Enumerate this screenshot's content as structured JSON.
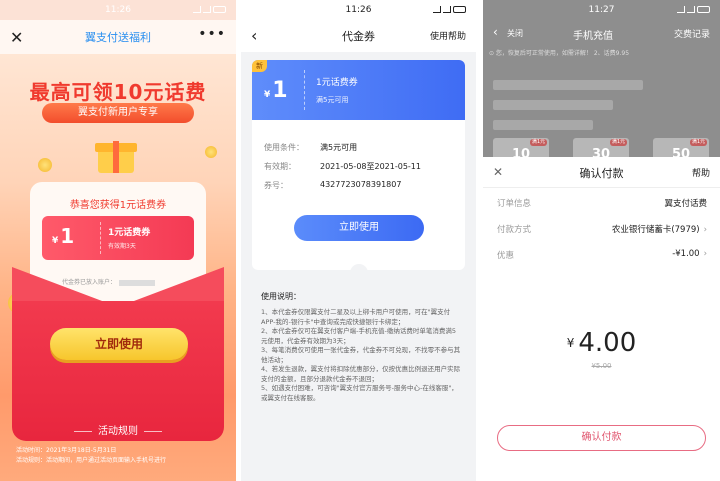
{
  "phone1": {
    "status_time": "11:26",
    "nav_title": "翼支付送福利",
    "close_glyph": "✕",
    "more_glyph": "•••",
    "hero_title": "最高可领10元话费",
    "hero_subtitle": "翼支付新用户专享",
    "congrats": "恭喜您获得1元话费券",
    "coupon_currency": "¥",
    "coupon_amount": "1",
    "coupon_name": "1元话费券",
    "coupon_validity": "有效期3天",
    "account_text": "代金券已放入账户：",
    "use_button": "立即使用",
    "rules_title": "活动规则",
    "activity_time_1": "活动时间：2021年3月18日-5月31日",
    "activity_time_2": "活动规则：活动期间，用户通过活动页面输入手机号进行"
  },
  "phone2": {
    "status_time": "11:26",
    "nav_title": "代金券",
    "back_glyph": "‹",
    "help": "使用帮助",
    "new_tag": "新",
    "currency": "¥",
    "amount": "1",
    "name": "1元话费券",
    "cond_short": "满5元可用",
    "rows": [
      {
        "label": "使用条件：",
        "value": "满5元可用"
      },
      {
        "label": "有效期：",
        "value": "2021-05-08至2021-05-11"
      },
      {
        "label": "券号：",
        "value": "4327723078391807"
      }
    ],
    "use_button": "立即使用",
    "instructions_title": "使用说明：",
    "instructions": [
      "1、本代金券仅限翼支付二星及以上绑卡用户可使用，可在\"翼支付APP-我的-银行卡\"中查询或完成快捷银行卡绑定；",
      "2、本代金券仅可在翼支付客户端-手机充值-缴纳话费时单笔消费满5元使用，代金券有效期为3天；",
      "3、每笔消费仅可使用一张代金券，代金券不可兑现，不找零不参与其他活动；",
      "4、若发生退款，翼支付将扣除优惠部分，仅按优惠比例退还用户实际支付的金额，且部分退款代金券不退回；",
      "5、如遇支付困难，可咨询\"翼支付官方服务号-服务中心-在线客服\"，或翼支付在线客服。"
    ]
  },
  "phone3": {
    "status_time": "11:27",
    "bg_back_glyph": "‹",
    "bg_close": "关闭",
    "bg_title": "手机充值",
    "bg_records": "交费记录",
    "bg_notice": "⊙  您，恢复后可正常使用，如需详解！  2、话费9.95",
    "bg_tiles": [
      {
        "value": "10",
        "tag": "满1元"
      },
      {
        "value": "30",
        "tag": "满1元"
      },
      {
        "value": "50",
        "tag": "满1元"
      }
    ],
    "sheet_title": "确认付款",
    "close_glyph": "✕",
    "help": "帮助",
    "rows": [
      {
        "label": "订单信息",
        "value": "翼支付话费",
        "chevron": false
      },
      {
        "label": "付款方式",
        "value": "农业银行储蓄卡(7979)",
        "chevron": true
      },
      {
        "label": "优惠",
        "value": "-¥1.00",
        "chevron": true
      }
    ],
    "chevron_glyph": "›",
    "currency": "¥",
    "pay_amount": "4.00",
    "original_amount": "¥5.00",
    "pay_button": "确认付款"
  },
  "colors": {
    "phone1_accent": "#f03a2e",
    "phone2_accent": "#3f6cf4",
    "phone3_accent": "#e0566f"
  }
}
